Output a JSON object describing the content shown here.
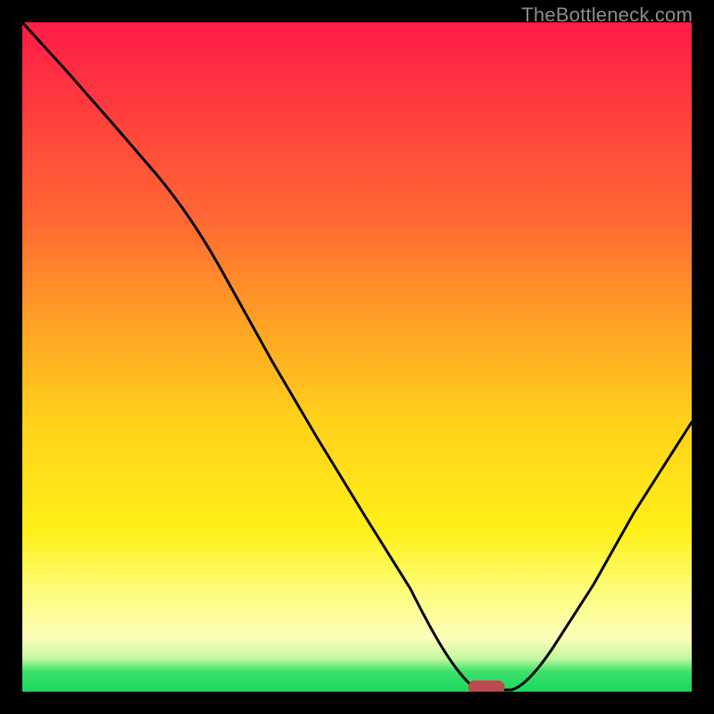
{
  "watermark": "TheBottleneck.com",
  "chart_data": {
    "type": "line",
    "title": "",
    "xlabel": "",
    "ylabel": "",
    "xlim": [
      0,
      1
    ],
    "ylim": [
      0,
      1
    ],
    "series": [
      {
        "name": "bottleneck-curve",
        "x": [
          0.0,
          0.06,
          0.12,
          0.18,
          0.24,
          0.3,
          0.36,
          0.42,
          0.48,
          0.54,
          0.6,
          0.64,
          0.68,
          0.72,
          0.78,
          0.84,
          0.9,
          0.96,
          1.0
        ],
        "y": [
          1.0,
          0.93,
          0.85,
          0.78,
          0.71,
          0.64,
          0.55,
          0.45,
          0.36,
          0.27,
          0.16,
          0.08,
          0.02,
          0.0,
          0.04,
          0.12,
          0.22,
          0.32,
          0.38
        ]
      }
    ],
    "marker": {
      "x": 0.69,
      "y": 0.0,
      "label": "optimal-point"
    },
    "gradient_stops": [
      {
        "pos": 0.0,
        "color": "#ff1b46"
      },
      {
        "pos": 0.3,
        "color": "#ff6a33"
      },
      {
        "pos": 0.6,
        "color": "#ffd21a"
      },
      {
        "pos": 0.92,
        "color": "#fbfdba"
      },
      {
        "pos": 1.0,
        "color": "#19d85e"
      }
    ]
  }
}
